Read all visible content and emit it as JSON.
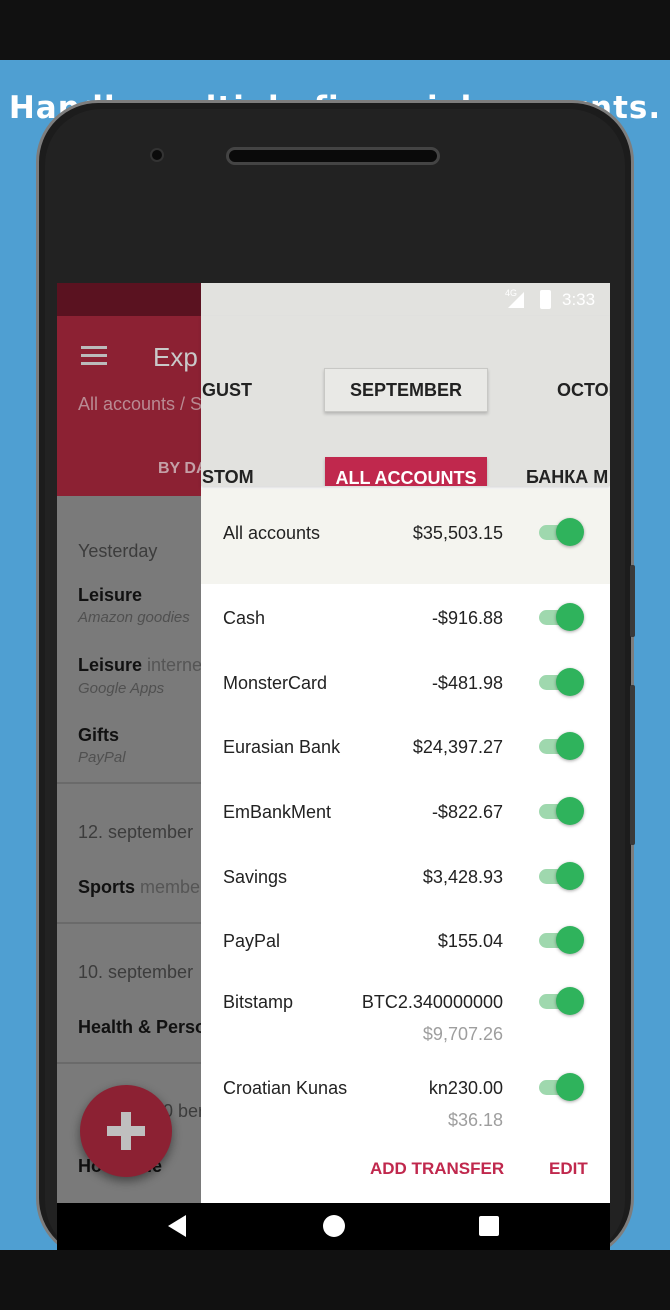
{
  "headline": "Handle multiple financial accounts.",
  "status": {
    "time": "3:33",
    "network": "4G"
  },
  "background_app": {
    "title": "Exp",
    "subtitle": "All accounts / S",
    "tab": "BY DA",
    "groups": [
      {
        "date": "Yesterday",
        "items": [
          {
            "category": "Leisure",
            "extra": "",
            "note": "Amazon goodies"
          },
          {
            "category": "Leisure",
            "extra": " interne",
            "note": "Google Apps"
          },
          {
            "category": "Gifts",
            "extra": "",
            "note": "PayPal"
          }
        ]
      },
      {
        "date": "12. september",
        "items": [
          {
            "category": "Sports",
            "extra": " membe",
            "note": ""
          }
        ]
      },
      {
        "date": "10. september",
        "items": [
          {
            "category": "Health & Perso",
            "extra": "",
            "note": ""
          }
        ]
      },
      {
        "date": "0     ber",
        "items": [
          {
            "category": "Ho    Utilitie",
            "extra": "",
            "note": ""
          }
        ]
      }
    ]
  },
  "sheet": {
    "months": {
      "prev": "GUST",
      "selected": "SEPTEMBER",
      "next": "OCTOB"
    },
    "account_filters": {
      "prev": "STOM",
      "selected": "ALL ACCOUNTS",
      "next": "БАНКА М"
    },
    "total": {
      "name": "All accounts",
      "value": "$35,503.15",
      "enabled": true
    },
    "accounts": [
      {
        "name": "Cash",
        "value": "-$916.88",
        "sub": "",
        "enabled": true
      },
      {
        "name": "MonsterCard",
        "value": "-$481.98",
        "sub": "",
        "enabled": true
      },
      {
        "name": "Eurasian Bank",
        "value": "$24,397.27",
        "sub": "",
        "enabled": true
      },
      {
        "name": "EmBankMent",
        "value": "-$822.67",
        "sub": "",
        "enabled": true
      },
      {
        "name": "Savings",
        "value": "$3,428.93",
        "sub": "",
        "enabled": true
      },
      {
        "name": "PayPal",
        "value": "$155.04",
        "sub": "",
        "enabled": true
      },
      {
        "name": "Bitstamp",
        "value": "BTC2.340000000",
        "sub": "$9,707.26",
        "enabled": true
      },
      {
        "name": "Croatian Kunas",
        "value": "kn230.00",
        "sub": "$36.18",
        "enabled": true
      }
    ],
    "actions": {
      "add_transfer": "ADD TRANSFER",
      "edit": "EDIT"
    }
  },
  "colors": {
    "backdrop": "#4f9fd2",
    "accent": "#c0284d",
    "toggle_on": "#2fb35c",
    "toolbar": "#8c2133"
  }
}
